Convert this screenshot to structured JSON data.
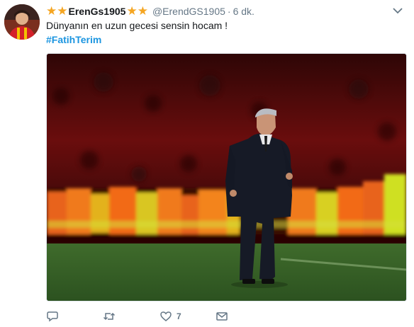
{
  "tweet": {
    "display_name": "ErenGs1905",
    "handle": "@ErendGS1905",
    "separator": "·",
    "time": "6 dk.",
    "text": "Dünyanın en uzun gecesi sensin hocam !",
    "hashtag": "#FatihTerim",
    "like_count": "7"
  },
  "icons": {
    "name_decoration": "star-icon",
    "menu": "chevron-down-icon",
    "reply": "reply-icon",
    "retweet": "retweet-icon",
    "like": "heart-icon",
    "message": "envelope-icon"
  },
  "colors": {
    "star": "#f5a623",
    "hashtag": "#1b95e0",
    "secondary_text": "#657786"
  }
}
